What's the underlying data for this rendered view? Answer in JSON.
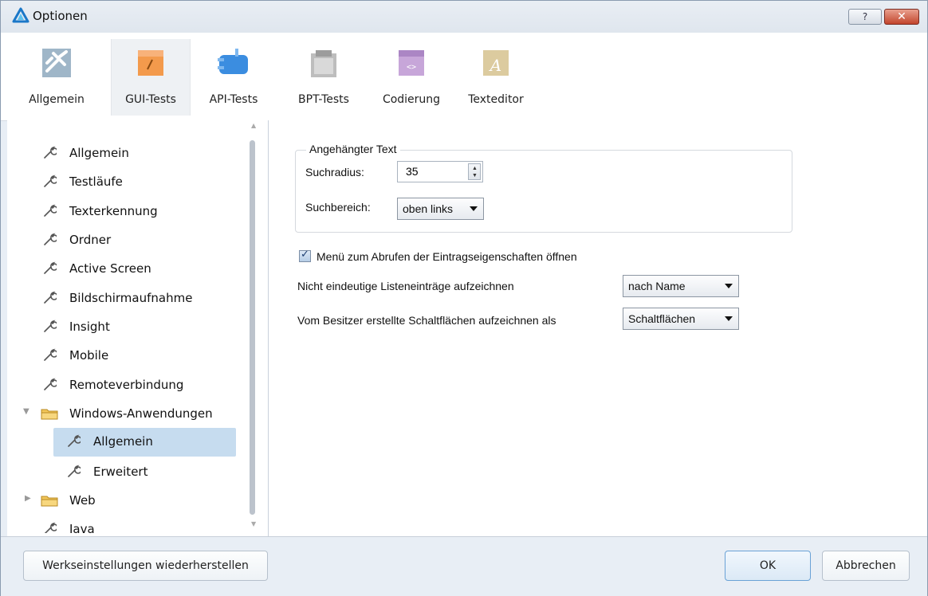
{
  "window": {
    "title": "Optionen",
    "help_label": "?",
    "close_label": "✕"
  },
  "toolbar": {
    "items": [
      {
        "label": "Allgemein",
        "icon": "tools-icon"
      },
      {
        "label": "GUI-Tests",
        "icon": "gui-tests-icon"
      },
      {
        "label": "API-Tests",
        "icon": "api-tests-icon"
      },
      {
        "label": "BPT-Tests",
        "icon": "bpt-tests-icon"
      },
      {
        "label": "Codierung",
        "icon": "code-icon"
      },
      {
        "label": "Texteditor",
        "icon": "text-editor-icon"
      }
    ],
    "active": "GUI-Tests"
  },
  "tree": {
    "items": [
      {
        "label": "Allgemein"
      },
      {
        "label": "Testläufe"
      },
      {
        "label": "Texterkennung"
      },
      {
        "label": "Ordner"
      },
      {
        "label": "Active Screen"
      },
      {
        "label": "Bildschirmaufnahme"
      },
      {
        "label": "Insight"
      },
      {
        "label": "Mobile"
      },
      {
        "label": "Remoteverbindung"
      },
      {
        "label": "Windows-Anwendungen"
      },
      {
        "label": "Allgemein"
      },
      {
        "label": "Erweitert"
      },
      {
        "label": "Web"
      },
      {
        "label": "Java"
      }
    ],
    "selected": "Windows-Anwendungen > Allgemein"
  },
  "settings": {
    "group_title": "Angehängter Text",
    "search_radius_label": "Suchradius:",
    "search_radius_value": "35",
    "search_area_label": "Suchbereich:",
    "search_area_value": "oben links",
    "open_menu_label": "Menü zum Abrufen der Eintragseigenschaften öffnen",
    "open_menu_checked": true,
    "ambiguous_label": "Nicht eindeutige Listeneinträge aufzeichnen",
    "ambiguous_value": "nach Name",
    "owner_buttons_label": "Vom Besitzer erstellte Schaltflächen aufzeichnen als",
    "owner_buttons_value": "Schaltflächen"
  },
  "buttons": {
    "restore": "Werkseinstellungen wiederherstellen",
    "ok": "OK",
    "cancel": "Abbrechen"
  },
  "colors": {
    "selection": "#c6dcef",
    "window_bg": "#e8eef5",
    "close_red": "#c2452c"
  }
}
